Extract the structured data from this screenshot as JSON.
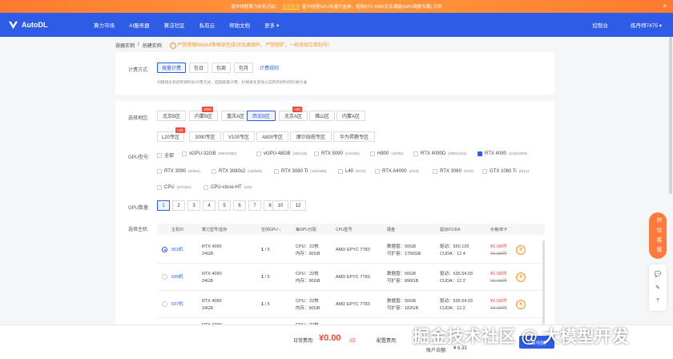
{
  "banner": {
    "pre": "夏中线程算力补贴活动：",
    "link": "点击获得",
    "post": "夏中线程GPU专属代金券，使用RTX 5090无法满额(GPU满额专属) 又称",
    "close": "×"
  },
  "nav": {
    "logo": "AutoDL",
    "links": [
      "算力市场",
      "AI服务器",
      "算法社区",
      "私有云",
      "帮助文档",
      "更多 ▾"
    ],
    "console": "控制台",
    "user": "炼丹师7475 ▾"
  },
  "breadcrumb": {
    "parent": "容器实例",
    "sep": "/",
    "current": "创建实例",
    "notice": "严禁使用WebUI等框架生成/涉及黄图片，严禁挖矿，一经发现立即封号!"
  },
  "billing": {
    "label": "计费方式:",
    "options": [
      "按量计费",
      "包日",
      "包周",
      "包月"
    ],
    "rules": "计费规则",
    "hint": "创建按主机后的按时长计费方式，固选按量计费，价格发生变动以实例开机时的价格为准"
  },
  "region": {
    "label": "选择地区:",
    "row1": [
      "北京B区",
      "内蒙B区",
      "重庆A区",
      "西北B区",
      "北京A区",
      "佛山区",
      "内蒙A区"
    ],
    "row2": [
      "L20专区",
      "3090专区",
      "V100专区",
      "A800专区",
      "摩尔线程专区",
      "华为昇腾专区"
    ],
    "tags": {
      "inner_b": "3090",
      "beijing_a": "H20",
      "l20": "L20"
    }
  },
  "gpu": {
    "label": "GPU型号:",
    "items": [
      {
        "name": "全部",
        "count": ""
      },
      {
        "name": "vGPU-32GB",
        "count": "(980/1882)"
      },
      {
        "name": "vGPU-48GB",
        "count": "(49/126)"
      },
      {
        "name": "RTX 5090",
        "count": "(14/150)"
      },
      {
        "name": "H800",
        "count": "(40/96)"
      },
      {
        "name": "RTX 4090D",
        "count": "(295/1211)"
      },
      {
        "name": "RTX 4090",
        "count": "(126/2269)"
      },
      {
        "name": "RTX 3090",
        "count": "(0/694)"
      },
      {
        "name": "RTX 3080x2",
        "count": "(18/586)"
      },
      {
        "name": "RTX 3080 Ti",
        "count": "(130/388)"
      },
      {
        "name": "L40",
        "count": "(0/13)"
      },
      {
        "name": "RTX A4000",
        "count": "(0/24)"
      },
      {
        "name": "RTX 3060",
        "count": "(0/32)"
      },
      {
        "name": "GTX 1080 Ti",
        "count": "(0/14)"
      },
      {
        "name": "CPU",
        "count": "(57/262)"
      },
      {
        "name": "CPU-close-HT",
        "count": "(2/6)"
      }
    ]
  },
  "gpu_count": {
    "label": "GPU数量:",
    "options": [
      "1",
      "2",
      "3",
      "4",
      "5",
      "6",
      "7",
      "8",
      "10",
      "12"
    ]
  },
  "host": {
    "label": "选择主机:",
    "headers": [
      "主机ID",
      "算力型号/显存",
      "空闲GPU ↕",
      "每GPU分配",
      "CPU型号",
      "硬盘",
      "驱动/CUDA",
      "价格/单卡"
    ],
    "rows": [
      {
        "id": "053机",
        "gpu": "RTX 4090",
        "mem": "24GB",
        "free": "1",
        "total": " / 5",
        "cpu": "CPU：22核",
        "ram": "内存：90GB",
        "cpu_model": "AMD EPYC 7T83",
        "disk": "数据盘：50GB",
        "expand": "可扩容：1750GB",
        "driver": "驱动：550.120",
        "cuda": "CUDA：12.4",
        "price": "¥2.08/时",
        "old": "¥2.18/时"
      },
      {
        "id": "039机",
        "gpu": "RTX 4090",
        "mem": "24GB",
        "free": "1",
        "total": " / 5",
        "cpu": "CPU：22核",
        "ram": "内存：90GB",
        "cpu_model": "AMD EPYC 7T83",
        "disk": "数据盘：50GB",
        "expand": "可扩容：898GB",
        "driver": "驱动：535.54.03",
        "cuda": "CUDA：12.2",
        "price": "¥2.08/时",
        "old": "¥2.18/时"
      },
      {
        "id": "037机",
        "gpu": "RTX 4090",
        "mem": "24GB",
        "free": "1",
        "total": " / 5",
        "cpu": "CPU：22核",
        "ram": "内存：90GB",
        "cpu_model": "AMD EPYC 7T83",
        "disk": "数据盘：50GB",
        "expand": "可扩容：182GB",
        "driver": "驱动：535.54.03",
        "cuda": "CUDA：12.2",
        "price": "¥2.08/时",
        "old": "¥2.18/时"
      },
      {
        "id": "",
        "gpu": "RTX 4090",
        "mem": "",
        "free": "",
        "total": "",
        "cpu": "CPU：22核",
        "ram": "",
        "cpu_model": "",
        "disk": "",
        "expand": "",
        "driver": "",
        "cuda": "",
        "price": "",
        "old": ""
      }
    ]
  },
  "footer": {
    "daily_label": "日常费用:",
    "daily_value": "¥0.00",
    "daily_unit": "/日",
    "config_label": "配置费用:",
    "balance_label": "账户余额:",
    "balance_value": "¥ 6.33",
    "create": "立即创建"
  },
  "service": "转 优 客 服",
  "watermark": "掘金技术社区 @ 大模型开发",
  "colors": {
    "primary": "#2f5ce6",
    "banner": "#ff7a2f",
    "price": "#f24b3c"
  }
}
